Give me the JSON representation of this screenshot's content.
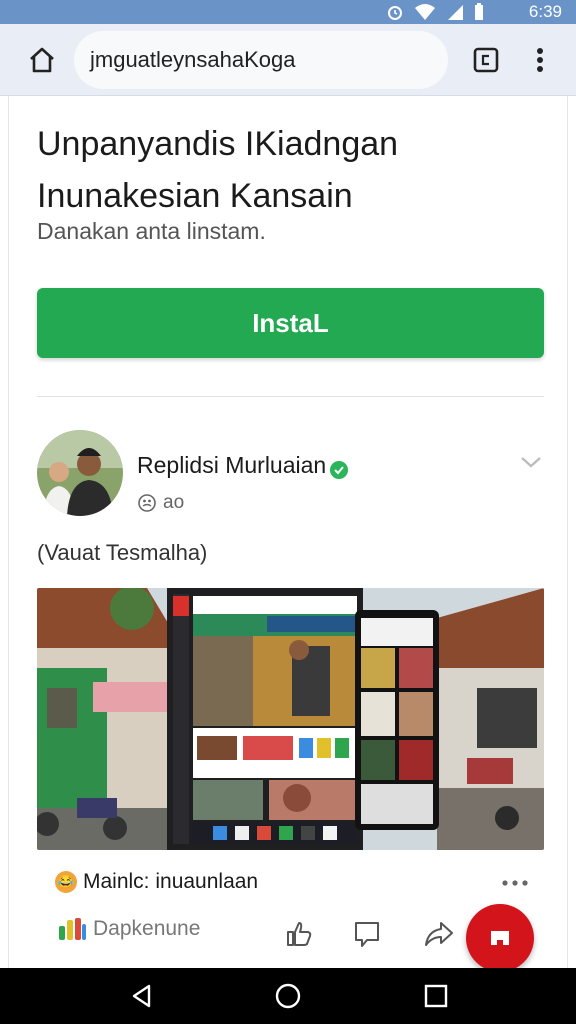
{
  "status_bar": {
    "time": "6:39",
    "icons": [
      "alarm-icon",
      "wifi-icon",
      "signal-icon",
      "battery-icon"
    ],
    "color": "#6a94c8"
  },
  "browser": {
    "url": "jmguatleynsahaKoga",
    "icons": [
      "home-icon",
      "tab-switcher-icon",
      "more-vert-icon"
    ]
  },
  "page": {
    "headline": "Unpanyandis IKiadngan Inunakesian Kansain",
    "subheadline": "Danakan anta linstam.",
    "install_label": "InstaL",
    "install_color": "#23a951"
  },
  "post": {
    "author": "Replidsi Murluaian",
    "meta": "ao",
    "caption": "(Vauat Tesmalha)",
    "title": "Mainlc: inuaunlaan",
    "app_label": "Dapkenune",
    "fab_color": "#d4141b"
  },
  "nav_bar": {
    "icons": [
      "back-icon",
      "home-circle-icon",
      "recents-icon"
    ]
  }
}
